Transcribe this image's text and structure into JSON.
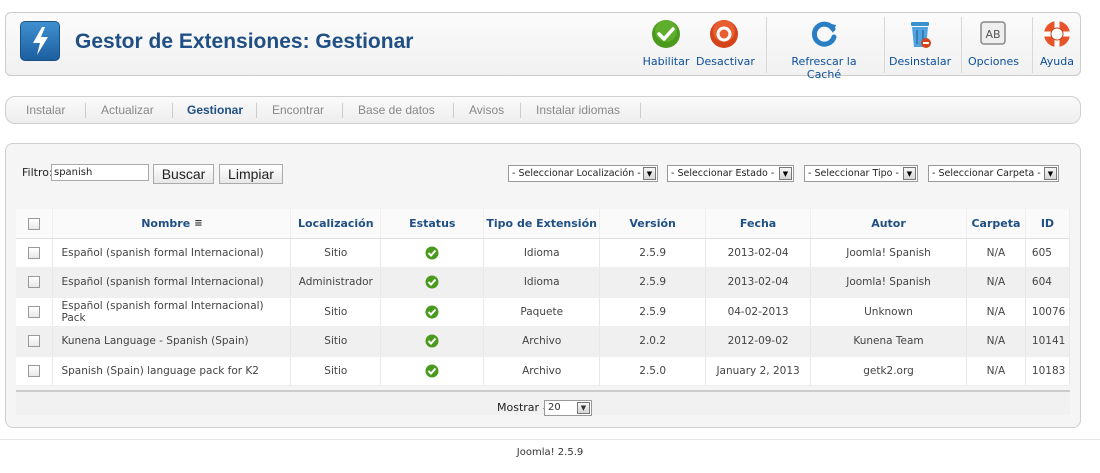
{
  "header": {
    "title": "Gestor de Extensiones: Gestionar",
    "buttons": [
      {
        "label": "Habilitar",
        "icon": "check-circle-icon"
      },
      {
        "label": "Desactivar",
        "icon": "stop-circle-icon"
      },
      {
        "label": "Refrescar la Caché",
        "icon": "refresh-icon"
      },
      {
        "label": "Desinstalar",
        "icon": "trash-icon"
      },
      {
        "label": "Opciones",
        "icon": "options-icon"
      },
      {
        "label": "Ayuda",
        "icon": "lifebuoy-icon"
      }
    ]
  },
  "submenu": {
    "items": [
      "Instalar",
      "Actualizar",
      "Gestionar",
      "Encontrar",
      "Base de datos",
      "Avisos",
      "Instalar idiomas"
    ],
    "active": "Gestionar"
  },
  "filter": {
    "label": "Filtro:",
    "value": "spanish",
    "search_button": "Buscar",
    "clear_button": "Limpiar",
    "selects": [
      "- Seleccionar Localización -",
      "- Seleccionar Estado -",
      "- Seleccionar Tipo -",
      "- Seleccionar Carpeta -"
    ]
  },
  "table": {
    "columns": [
      "Nombre",
      "Localización",
      "Estatus",
      "Tipo de Extensión",
      "Versión",
      "Fecha",
      "Autor",
      "Carpeta",
      "ID"
    ],
    "rows": [
      {
        "name": "Español (spanish formal Internacional)",
        "location": "Sitio",
        "type": "Idioma",
        "version": "2.5.9",
        "date": "2013-02-04",
        "author": "Joomla! Spanish",
        "folder": "N/A",
        "id": "605"
      },
      {
        "name": "Español (spanish formal Internacional)",
        "location": "Administrador",
        "type": "Idioma",
        "version": "2.5.9",
        "date": "2013-02-04",
        "author": "Joomla! Spanish",
        "folder": "N/A",
        "id": "604"
      },
      {
        "name": "Español (spanish formal Internacional) Pack",
        "location": "Sitio",
        "type": "Paquete",
        "version": "2.5.9",
        "date": "04-02-2013",
        "author": "Unknown",
        "folder": "N/A",
        "id": "10076"
      },
      {
        "name": "Kunena Language - Spanish (Spain)",
        "location": "Sitio",
        "type": "Archivo",
        "version": "2.0.2",
        "date": "2012-09-02",
        "author": "Kunena Team",
        "folder": "N/A",
        "id": "10141"
      },
      {
        "name": "Spanish (Spain) language pack for K2",
        "location": "Sitio",
        "type": "Archivo",
        "version": "2.5.0",
        "date": "January 2, 2013",
        "author": "getk2.org",
        "folder": "N/A",
        "id": "10183"
      }
    ]
  },
  "pagination": {
    "label": "Mostrar #",
    "value": "20"
  },
  "footer": {
    "version": "Joomla! 2.5.9"
  },
  "colors": {
    "title": "#1f4f84",
    "link": "#0b4f9b",
    "enabled": "#4a9a1e"
  }
}
